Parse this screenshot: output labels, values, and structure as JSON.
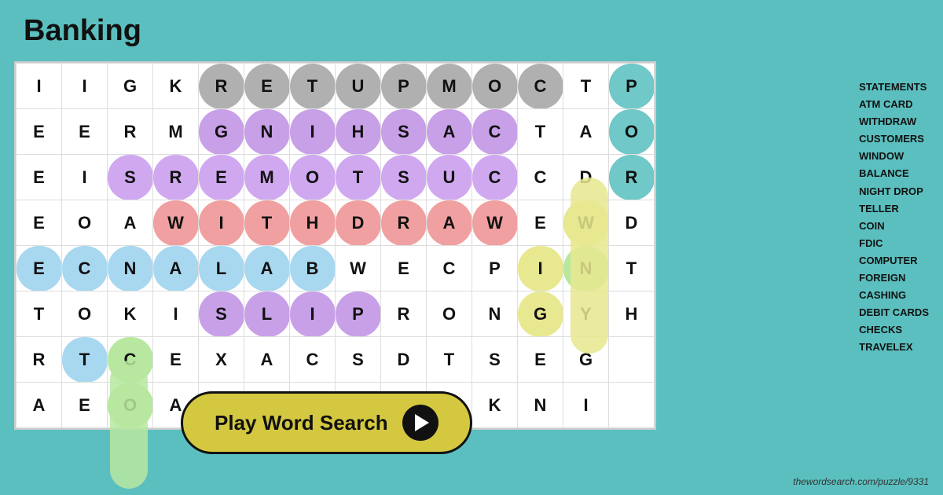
{
  "title": "Banking",
  "attribution": "thewordsearch.com/puzzle/9331",
  "play_button_label": "Play Word Search",
  "word_list": [
    "STATEMENTS",
    "ATM CARD",
    "WITHDRAW",
    "CUSTOMERS",
    "WINDOW",
    "BALANCE",
    "NIGHT DROP",
    "TELLER",
    "COIN",
    "FDIC",
    "COMPUTER",
    "FOREIGN",
    "CASHING",
    "DEBIT CARDS",
    "CHECKS",
    "TRAVELEX"
  ],
  "grid": [
    [
      "I",
      "I",
      "G",
      "K",
      "R",
      "E",
      "T",
      "U",
      "P",
      "M",
      "O",
      "C",
      "T",
      "P"
    ],
    [
      "E",
      "E",
      "R",
      "M",
      "G",
      "N",
      "I",
      "H",
      "S",
      "A",
      "C",
      "T",
      "A",
      "O"
    ],
    [
      "E",
      "I",
      "S",
      "R",
      "E",
      "M",
      "O",
      "T",
      "S",
      "U",
      "C",
      "C",
      "D",
      "R"
    ],
    [
      "E",
      "O",
      "A",
      "W",
      "I",
      "T",
      "H",
      "D",
      "R",
      "A",
      "W",
      "E",
      "W",
      "D"
    ],
    [
      "E",
      "C",
      "N",
      "A",
      "L",
      "A",
      "B",
      "W",
      "E",
      "C",
      "P",
      "I",
      "N",
      "T"
    ],
    [
      "T",
      "O",
      "K",
      "I",
      "S",
      "L",
      "I",
      "P",
      "R",
      "O",
      "N",
      "G",
      "Y",
      "H"
    ],
    [
      "R",
      "T",
      "C",
      "E",
      "X",
      "A",
      "C",
      "S",
      "D",
      "T",
      "S",
      "E",
      "G",
      ""
    ],
    [
      "A",
      "E",
      "O",
      "A",
      "",
      "",
      "",
      "",
      "",
      "",
      "K",
      "N",
      "I",
      ""
    ]
  ]
}
